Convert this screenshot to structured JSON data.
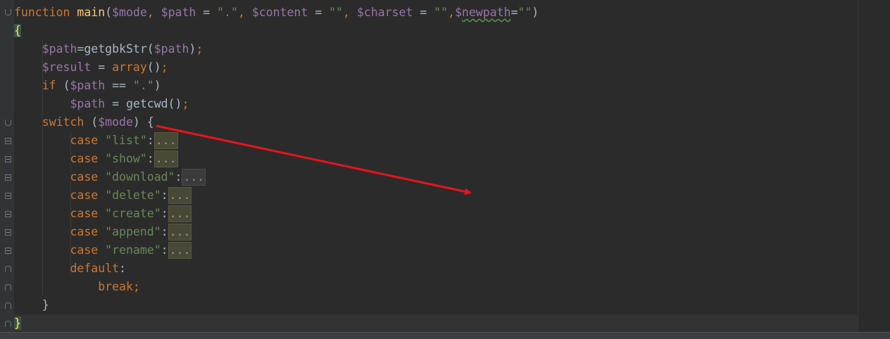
{
  "editor": {
    "language": "php",
    "lines": [
      [
        {
          "t": "kw",
          "v": "function "
        },
        {
          "t": "fn",
          "v": "main"
        },
        {
          "t": "pl",
          "v": "("
        },
        {
          "t": "var",
          "v": "$mode"
        },
        {
          "t": "kw",
          "v": ", "
        },
        {
          "t": "var",
          "v": "$path"
        },
        {
          "t": "pl",
          "v": " = "
        },
        {
          "t": "str",
          "v": "\".\""
        },
        {
          "t": "kw",
          "v": ", "
        },
        {
          "t": "var",
          "v": "$content"
        },
        {
          "t": "pl",
          "v": " = "
        },
        {
          "t": "str",
          "v": "\"\""
        },
        {
          "t": "kw",
          "v": ", "
        },
        {
          "t": "var",
          "v": "$charset"
        },
        {
          "t": "pl",
          "v": " = "
        },
        {
          "t": "str",
          "v": "\"\""
        },
        {
          "t": "kw",
          "v": ","
        },
        {
          "t": "var",
          "v": "$"
        },
        {
          "t": "var squiggle",
          "v": "newpath"
        },
        {
          "t": "pl",
          "v": "="
        },
        {
          "t": "str",
          "v": "\"\""
        },
        {
          "t": "pl",
          "v": ")"
        }
      ],
      [
        {
          "t": "brace-hl",
          "v": "{"
        }
      ],
      [
        {
          "t": "pl",
          "v": "    "
        },
        {
          "t": "var",
          "v": "$path"
        },
        {
          "t": "pl",
          "v": "=getgbkStr("
        },
        {
          "t": "var",
          "v": "$path"
        },
        {
          "t": "pl",
          "v": ")"
        },
        {
          "t": "kw",
          "v": ";"
        }
      ],
      [
        {
          "t": "pl",
          "v": "    "
        },
        {
          "t": "var",
          "v": "$result"
        },
        {
          "t": "pl",
          "v": " = "
        },
        {
          "t": "kw",
          "v": "array"
        },
        {
          "t": "pl",
          "v": "()"
        },
        {
          "t": "kw",
          "v": ";"
        }
      ],
      [
        {
          "t": "pl",
          "v": "    "
        },
        {
          "t": "kw",
          "v": "if "
        },
        {
          "t": "pl",
          "v": "("
        },
        {
          "t": "var",
          "v": "$path"
        },
        {
          "t": "pl",
          "v": " == "
        },
        {
          "t": "str",
          "v": "\".\""
        },
        {
          "t": "pl",
          "v": ")"
        }
      ],
      [
        {
          "t": "pl",
          "v": "        "
        },
        {
          "t": "var",
          "v": "$path"
        },
        {
          "t": "pl",
          "v": " = getcwd()"
        },
        {
          "t": "kw",
          "v": ";"
        }
      ],
      [
        {
          "t": "pl",
          "v": "    "
        },
        {
          "t": "kw",
          "v": "switch "
        },
        {
          "t": "pl",
          "v": "("
        },
        {
          "t": "var",
          "v": "$mode"
        },
        {
          "t": "pl",
          "v": ") {"
        }
      ],
      [
        {
          "t": "pl",
          "v": "        "
        },
        {
          "t": "kw",
          "v": "case "
        },
        {
          "t": "str",
          "v": "\"list\""
        },
        {
          "t": "pl",
          "v": ":"
        },
        {
          "t": "fold-ph",
          "v": "..."
        }
      ],
      [
        {
          "t": "pl",
          "v": "        "
        },
        {
          "t": "kw",
          "v": "case "
        },
        {
          "t": "str",
          "v": "\"show\""
        },
        {
          "t": "pl",
          "v": ":"
        },
        {
          "t": "fold-ph",
          "v": "..."
        }
      ],
      [
        {
          "t": "pl",
          "v": "        "
        },
        {
          "t": "kw",
          "v": "case "
        },
        {
          "t": "str",
          "v": "\"download\""
        },
        {
          "t": "pl",
          "v": ":"
        },
        {
          "t": "fold-ph gray",
          "v": "..."
        }
      ],
      [
        {
          "t": "pl",
          "v": "        "
        },
        {
          "t": "kw",
          "v": "case "
        },
        {
          "t": "str",
          "v": "\"delete\""
        },
        {
          "t": "pl",
          "v": ":"
        },
        {
          "t": "fold-ph",
          "v": "..."
        }
      ],
      [
        {
          "t": "pl",
          "v": "        "
        },
        {
          "t": "kw",
          "v": "case "
        },
        {
          "t": "str",
          "v": "\"create\""
        },
        {
          "t": "pl",
          "v": ":"
        },
        {
          "t": "fold-ph",
          "v": "..."
        }
      ],
      [
        {
          "t": "pl",
          "v": "        "
        },
        {
          "t": "kw",
          "v": "case "
        },
        {
          "t": "str",
          "v": "\"append\""
        },
        {
          "t": "pl",
          "v": ":"
        },
        {
          "t": "fold-ph",
          "v": "..."
        }
      ],
      [
        {
          "t": "pl",
          "v": "        "
        },
        {
          "t": "kw",
          "v": "case "
        },
        {
          "t": "str",
          "v": "\"rename\""
        },
        {
          "t": "pl",
          "v": ":"
        },
        {
          "t": "fold-ph",
          "v": "..."
        }
      ],
      [
        {
          "t": "pl",
          "v": "        "
        },
        {
          "t": "kw",
          "v": "default"
        },
        {
          "t": "pl",
          "v": ":"
        }
      ],
      [
        {
          "t": "pl",
          "v": "            "
        },
        {
          "t": "kw",
          "v": "break;"
        }
      ],
      [
        {
          "t": "pl",
          "v": "    }"
        }
      ],
      [
        {
          "t": "brace-hl",
          "v": "}"
        }
      ]
    ],
    "current_line": 17
  },
  "annotation": {
    "color": "#e8141c",
    "kind": "arrow",
    "target": "switch-statement-brace"
  }
}
